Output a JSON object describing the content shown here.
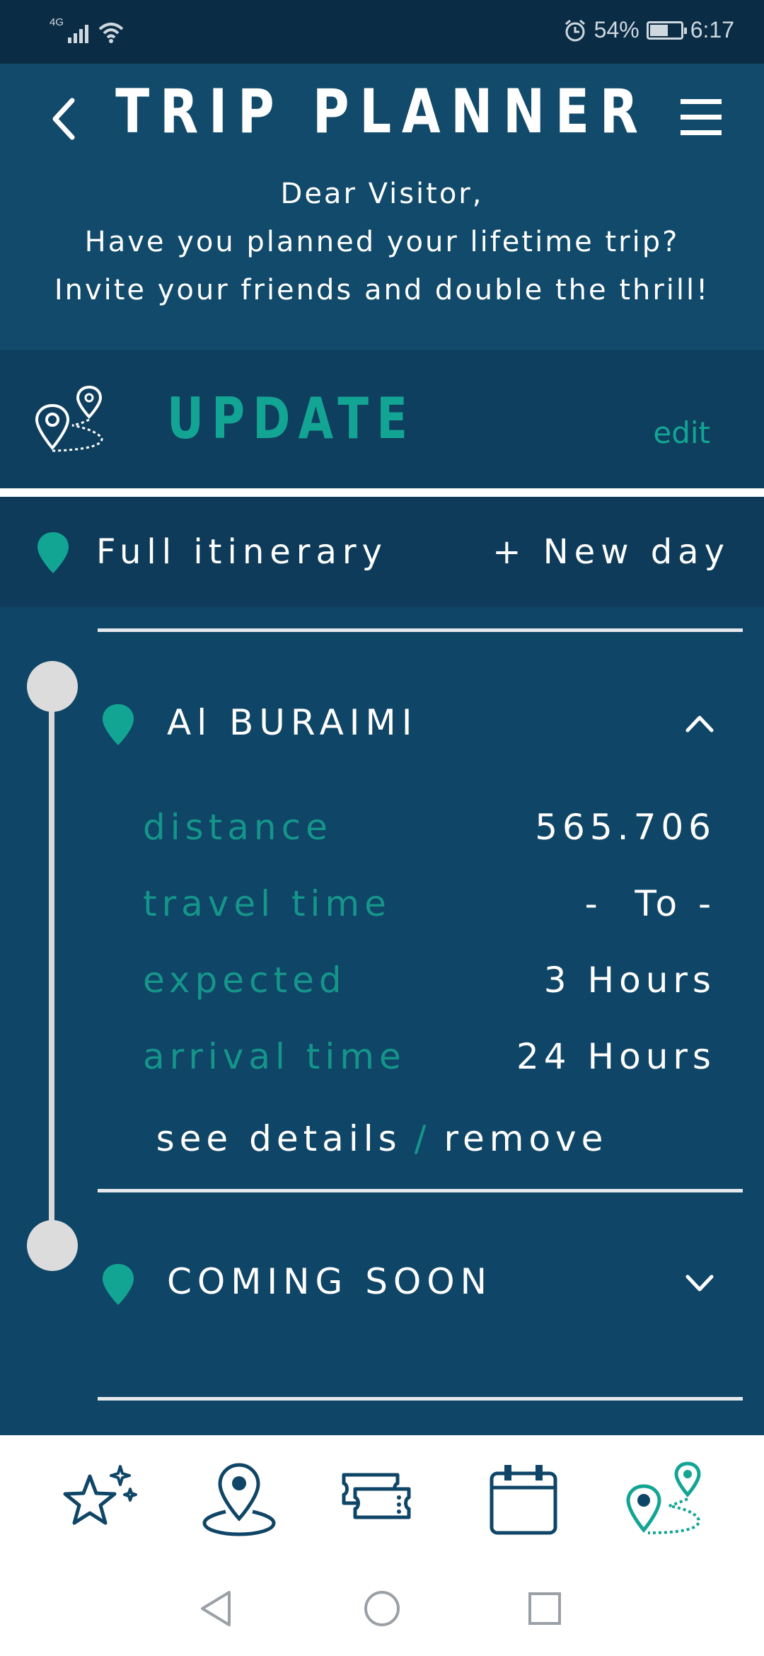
{
  "status_bar": {
    "network": "4G",
    "battery_percent": "54%",
    "battery_level": 0.54,
    "time": "6:17",
    "icons": [
      "signal-icon",
      "wifi-icon",
      "alarm-icon",
      "battery-icon"
    ]
  },
  "header": {
    "title": "TRIP PLANNER",
    "greeting_line1": "Dear Visitor,",
    "greeting_line2": "Have you planned your lifetime trip?",
    "greeting_line3": "Invite your friends and double the thrill!"
  },
  "update": {
    "title": "UPDATE",
    "edit_label": "edit"
  },
  "itinerary": {
    "label": "Full itinerary",
    "new_day_label": "+ New day"
  },
  "stops": [
    {
      "name": "Al BURAIMI",
      "expanded": true,
      "rows": [
        {
          "label": "distance",
          "value": "565.706"
        },
        {
          "label": "travel time",
          "value": "-  To -"
        },
        {
          "label": "expected",
          "value": "3 Hours"
        },
        {
          "label": "arrival time",
          "value": "24 Hours"
        }
      ],
      "details_label": "see details",
      "separator": "/",
      "remove_label": "remove"
    },
    {
      "name": "COMING SOON",
      "expanded": false
    }
  ],
  "colors": {
    "background": "#0f4566",
    "accent": "#13a594",
    "header": "#114a6a"
  },
  "bottom_nav": [
    "stars-icon",
    "location-icon",
    "tickets-icon",
    "calendar-icon",
    "route-icon"
  ],
  "active_nav": "route-icon"
}
